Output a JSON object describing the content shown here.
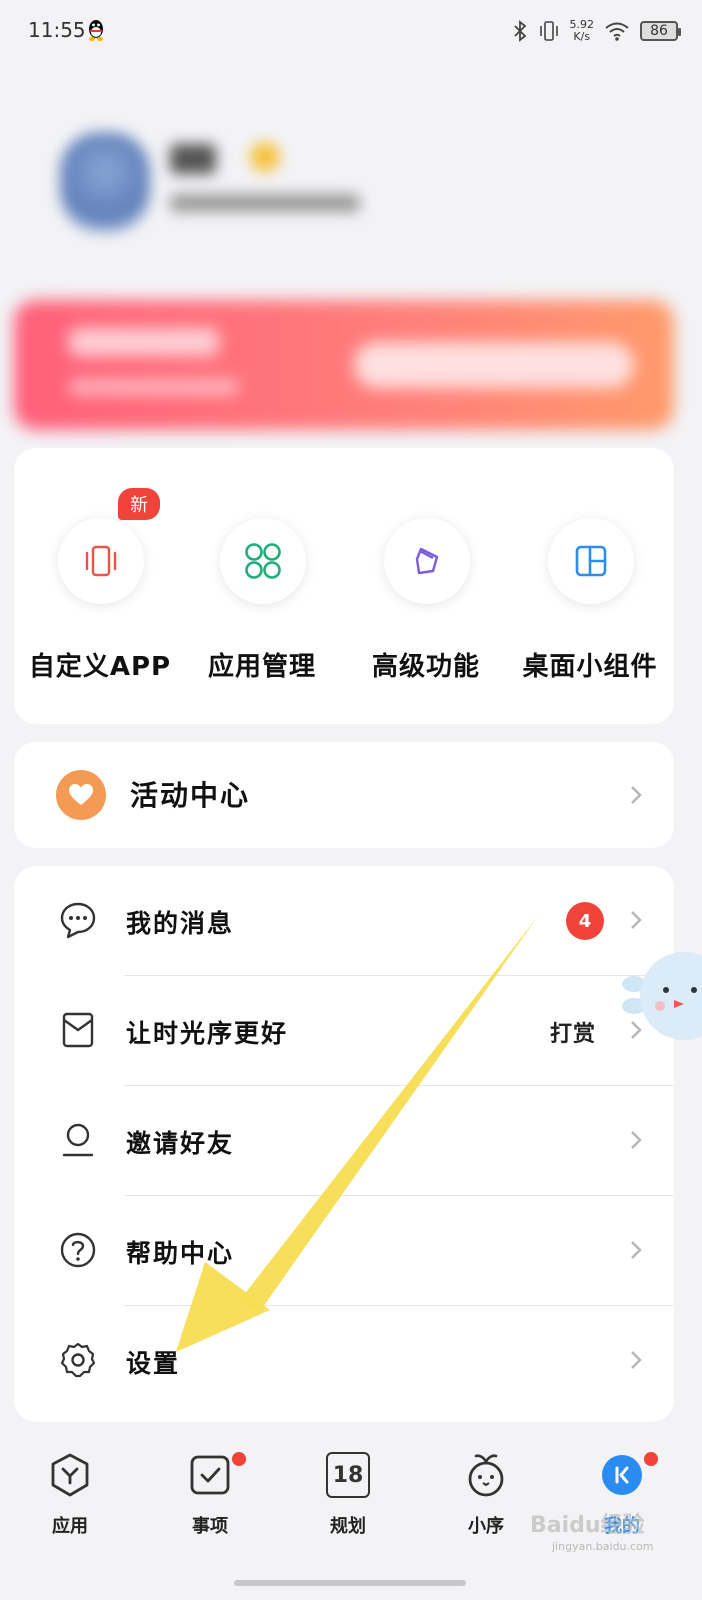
{
  "status_bar": {
    "time": "11:55",
    "net_speed_value": "5.92",
    "net_speed_unit": "K/s",
    "battery": "86"
  },
  "tools": {
    "new_badge": "新",
    "items": [
      {
        "label": "自定义APP",
        "icon": "phone-vibrate-icon"
      },
      {
        "label": "应用管理",
        "icon": "apps-grid-icon"
      },
      {
        "label": "高级功能",
        "icon": "pen-nib-icon"
      },
      {
        "label": "桌面小组件",
        "icon": "widget-layout-icon"
      }
    ]
  },
  "activity": {
    "label": "活动中心",
    "icon": "heart-icon",
    "accent": "#f59a54"
  },
  "menu": {
    "items": [
      {
        "label": "我的消息",
        "icon": "message-icon",
        "badge": "4"
      },
      {
        "label": "让时光序更好",
        "icon": "reward-envelope-icon",
        "extra": "打赏"
      },
      {
        "label": "邀请好友",
        "icon": "person-icon"
      },
      {
        "label": "帮助中心",
        "icon": "help-icon"
      },
      {
        "label": "设置",
        "icon": "gear-icon"
      }
    ]
  },
  "tabbar": {
    "items": [
      {
        "label": "应用",
        "icon": "apps-hexagon-icon"
      },
      {
        "label": "事项",
        "icon": "checkbox-icon",
        "dot": true
      },
      {
        "label": "规划",
        "icon": "calendar-icon",
        "date": "18"
      },
      {
        "label": "小序",
        "icon": "mascot-icon"
      },
      {
        "label": "我的",
        "icon": "profile-icon",
        "dot": true,
        "active": true
      }
    ],
    "active_color": "#2a8cf0"
  },
  "watermark": {
    "brand": "Baidu经验",
    "url": "jingyan.baidu.com"
  },
  "colors": {
    "badge_red": "#f0443a",
    "arrow_yellow": "#f7dc52",
    "background": "#f3f3f6"
  }
}
